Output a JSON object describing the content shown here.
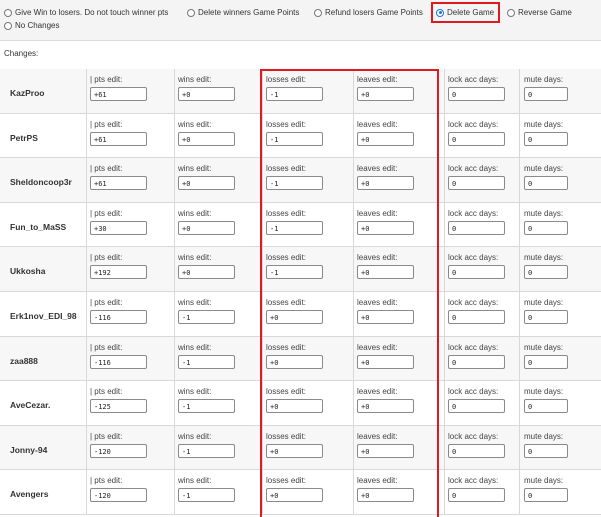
{
  "options": [
    {
      "label": "Give Win to losers. Do not touch winner pts",
      "selected": false
    },
    {
      "label": "Delete winners Game Points",
      "selected": false
    },
    {
      "label": "Refund losers Game Points",
      "selected": false
    },
    {
      "label": "Delete Game",
      "selected": true
    },
    {
      "label": "Reverse Game",
      "selected": false
    },
    {
      "label": "No Changes",
      "selected": false
    }
  ],
  "changes_label": "Changes:",
  "labels": {
    "pts": "| pts edit:",
    "wins": "wins edit:",
    "losses": "losses edit:",
    "leaves": "leaves edit:",
    "lock": "lock acc days:",
    "mute": "mute days:"
  },
  "players": [
    {
      "name": "KazProo",
      "pts": "+61",
      "wins": "+0",
      "losses": "-1",
      "leaves": "+0",
      "lock": "0",
      "mute": "0"
    },
    {
      "name": "PetrPS",
      "pts": "+61",
      "wins": "+0",
      "losses": "-1",
      "leaves": "+0",
      "lock": "0",
      "mute": "0"
    },
    {
      "name": "Sheldoncoop3r",
      "pts": "+61",
      "wins": "+0",
      "losses": "-1",
      "leaves": "+0",
      "lock": "0",
      "mute": "0"
    },
    {
      "name": "Fun_to_MaSS",
      "pts": "+30",
      "wins": "+0",
      "losses": "-1",
      "leaves": "+0",
      "lock": "0",
      "mute": "0"
    },
    {
      "name": "Ukkosha",
      "pts": "+192",
      "wins": "+0",
      "losses": "-1",
      "leaves": "+0",
      "lock": "0",
      "mute": "0"
    },
    {
      "name": "Erk1nov_EDI_98",
      "pts": "-116",
      "wins": "-1",
      "losses": "+0",
      "leaves": "+0",
      "lock": "0",
      "mute": "0"
    },
    {
      "name": "zaa888",
      "pts": "-116",
      "wins": "-1",
      "losses": "+0",
      "leaves": "+0",
      "lock": "0",
      "mute": "0"
    },
    {
      "name": "AveCezar.",
      "pts": "-125",
      "wins": "-1",
      "losses": "+0",
      "leaves": "+0",
      "lock": "0",
      "mute": "0"
    },
    {
      "name": "Jonny-94",
      "pts": "-120",
      "wins": "-1",
      "losses": "+0",
      "leaves": "+0",
      "lock": "0",
      "mute": "0"
    },
    {
      "name": "Avengers",
      "pts": "-120",
      "wins": "-1",
      "losses": "+0",
      "leaves": "+0",
      "lock": "0",
      "mute": "0"
    }
  ],
  "colors": {
    "highlight": "#e0191e",
    "radio_selected": "#1a73e8"
  }
}
